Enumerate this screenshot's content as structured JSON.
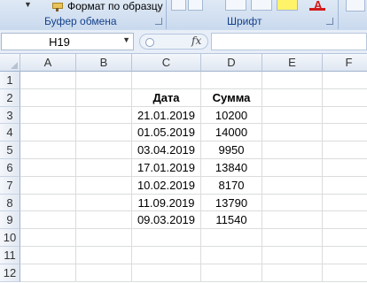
{
  "ribbon": {
    "copy_format_label": "Формат по образцу",
    "clipboard_group": "Буфер обмена",
    "font_group": "Шрифт"
  },
  "formula_bar": {
    "name_box": "H19",
    "fx_label": "fx",
    "formula_value": ""
  },
  "sheet": {
    "columns": [
      "A",
      "B",
      "C",
      "D",
      "E",
      "F"
    ],
    "rows": [
      "1",
      "2",
      "3",
      "4",
      "5",
      "6",
      "7",
      "8",
      "9",
      "10",
      "11",
      "12"
    ],
    "headers": {
      "date": "Дата",
      "sum": "Сумма"
    },
    "records": [
      {
        "date": "21.01.2019",
        "sum": "10200"
      },
      {
        "date": "01.05.2019",
        "sum": "14000"
      },
      {
        "date": "03.04.2019",
        "sum": "9950"
      },
      {
        "date": "17.01.2019",
        "sum": "13840"
      },
      {
        "date": "10.02.2019",
        "sum": "8170"
      },
      {
        "date": "11.09.2019",
        "sum": "13790"
      },
      {
        "date": "09.03.2019",
        "sum": "11540"
      }
    ]
  }
}
